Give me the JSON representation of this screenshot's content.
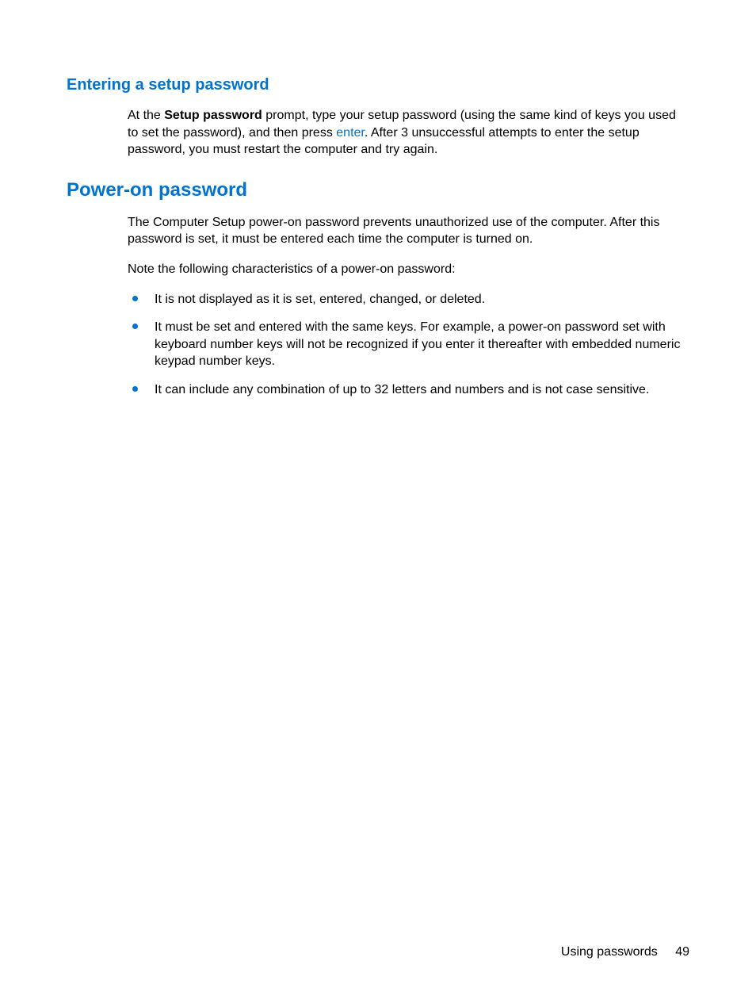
{
  "section1": {
    "heading": "Entering a setup password",
    "para_pre": "At the ",
    "para_bold": "Setup password",
    "para_mid": " prompt, type your setup password (using the same kind of keys you used to set the password), and then press ",
    "para_link": "enter",
    "para_post": ". After 3 unsuccessful attempts to enter the setup password, you must restart the computer and try again."
  },
  "section2": {
    "heading": "Power-on password",
    "para1": "The Computer Setup power-on password prevents unauthorized use of the computer. After this password is set, it must be entered each time the computer is turned on.",
    "para2": "Note the following characteristics of a power-on password:",
    "bullets": [
      "It is not displayed as it is set, entered, changed, or deleted.",
      "It must be set and entered with the same keys. For example, a power-on password set with keyboard number keys will not be recognized if you enter it thereafter with embedded numeric keypad number keys.",
      "It can include any combination of up to 32 letters and numbers and is not case sensitive."
    ]
  },
  "footer": {
    "section": "Using passwords",
    "page": "49"
  }
}
